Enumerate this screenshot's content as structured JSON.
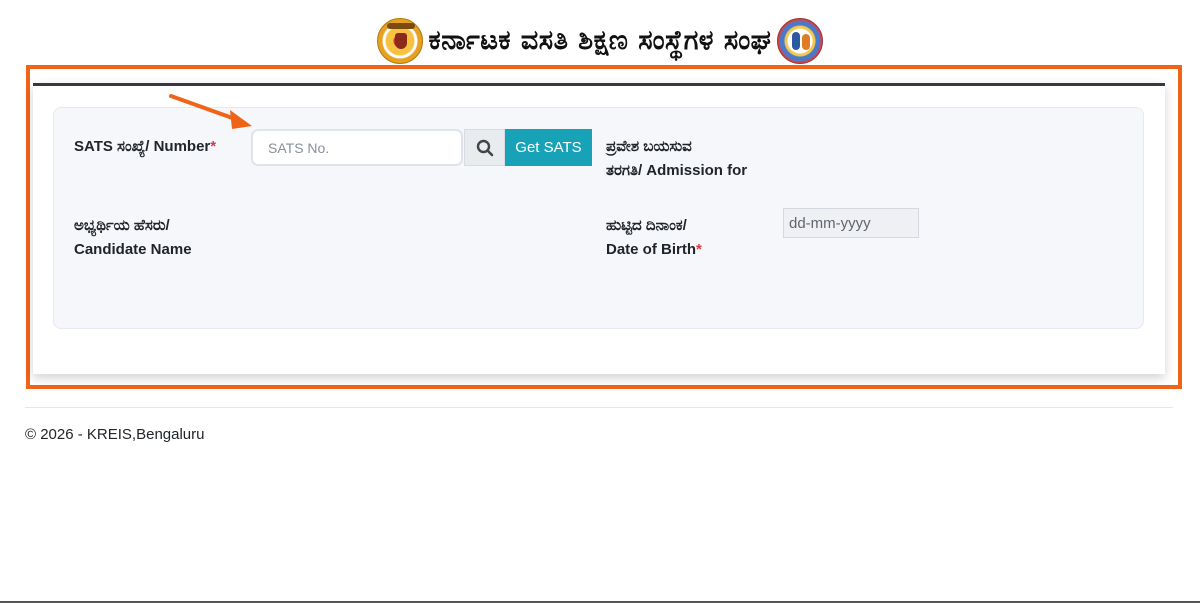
{
  "header": {
    "title": "ಕರ್ನಾಟಕ ವಸತಿ ಶಿಕ್ಷಣ ಸಂಸ್ಥೆಗಳ ಸಂಘ",
    "left_logo_icon": "karnataka-emblem-icon",
    "right_logo_icon": "kreis-emblem-icon"
  },
  "form": {
    "sats_label": "SATS ಸಂಖ್ಯೆ/ Number",
    "required_mark": "*",
    "sats_placeholder": "SATS No.",
    "search_icon": "search-icon",
    "get_sats_label": "Get SATS",
    "admission_label_kn": "ಪ್ರವೇಶ ಬಯಸುವ",
    "admission_label_rest": "ತರಗತಿ/ Admission for",
    "candidate_label_kn": "ಅಭ್ಯರ್ಥಿಯ ಹೆಸರು/",
    "candidate_label_en": "Candidate Name",
    "dob_label_kn": "ಹುಟ್ಟಿದ ದಿನಾಂಕ/",
    "dob_label_en": "Date of Birth",
    "dob_placeholder": "dd-mm-yyyy"
  },
  "footer": {
    "copyright": "© 2026 - KREIS,Bengaluru"
  },
  "colors": {
    "highlight_border": "#f06418",
    "button_accent": "#17a2b8",
    "required": "#dc3545"
  }
}
